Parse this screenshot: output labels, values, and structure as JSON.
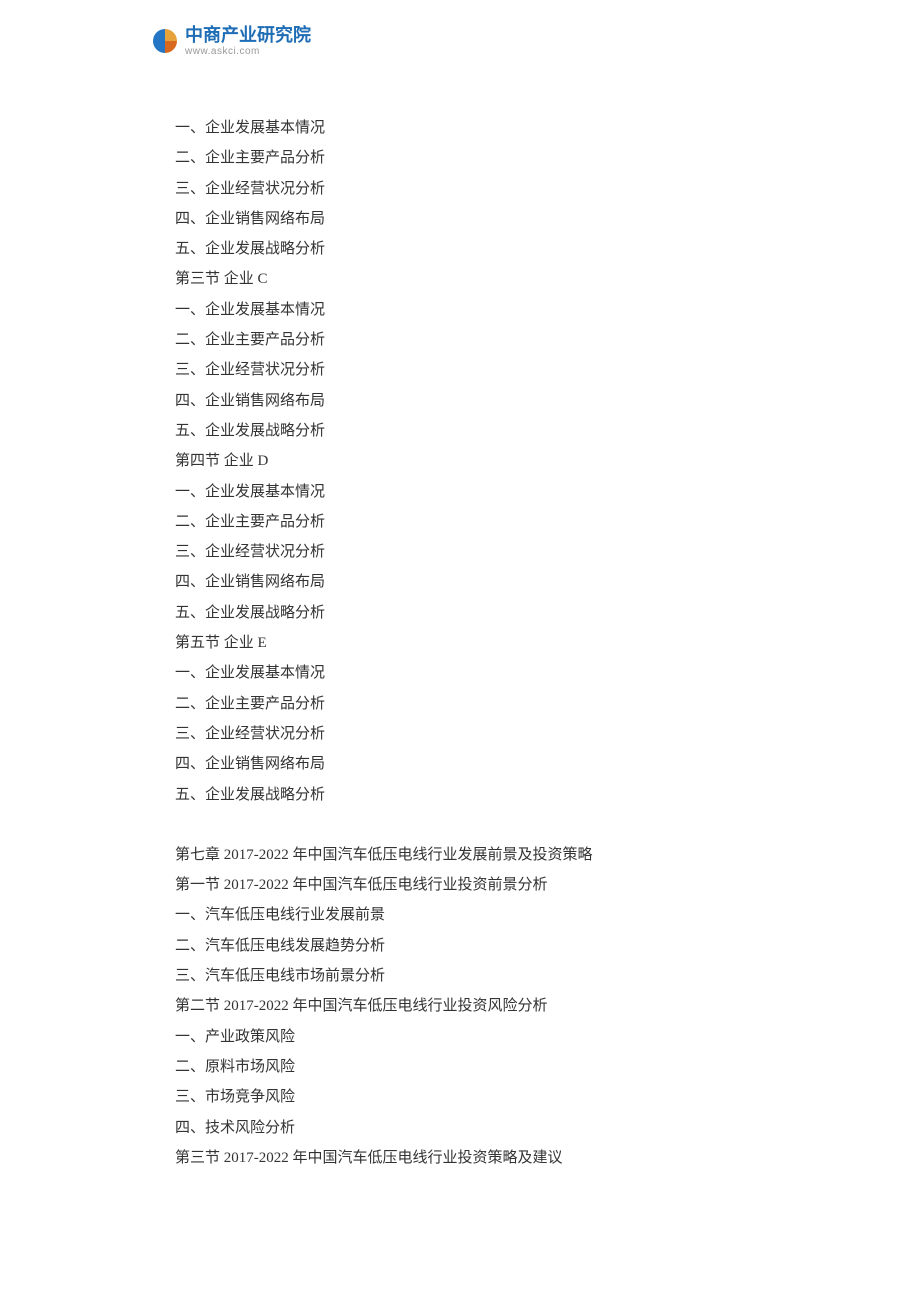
{
  "logo": {
    "name_cn": "中商产业研究院",
    "name_en": "www.askci.com"
  },
  "lines": [
    "一、企业发展基本情况",
    "二、企业主要产品分析",
    "三、企业经营状况分析",
    "四、企业销售网络布局",
    "五、企业发展战略分析",
    "第三节 企业 C",
    "一、企业发展基本情况",
    "二、企业主要产品分析",
    "三、企业经营状况分析",
    "四、企业销售网络布局",
    "五、企业发展战略分析",
    "第四节 企业 D",
    "一、企业发展基本情况",
    "二、企业主要产品分析",
    "三、企业经营状况分析",
    "四、企业销售网络布局",
    "五、企业发展战略分析",
    "第五节 企业 E",
    "一、企业发展基本情况",
    "二、企业主要产品分析",
    "三、企业经营状况分析",
    "四、企业销售网络布局",
    "五、企业发展战略分析",
    "",
    "第七章 2017-2022 年中国汽车低压电线行业发展前景及投资策略",
    "第一节 2017-2022 年中国汽车低压电线行业投资前景分析",
    "一、汽车低压电线行业发展前景",
    "二、汽车低压电线发展趋势分析",
    "三、汽车低压电线市场前景分析",
    "第二节 2017-2022 年中国汽车低压电线行业投资风险分析",
    "一、产业政策风险",
    "二、原料市场风险",
    "三、市场竞争风险",
    "四、技术风险分析",
    "第三节 2017-2022 年中国汽车低压电线行业投资策略及建议"
  ]
}
